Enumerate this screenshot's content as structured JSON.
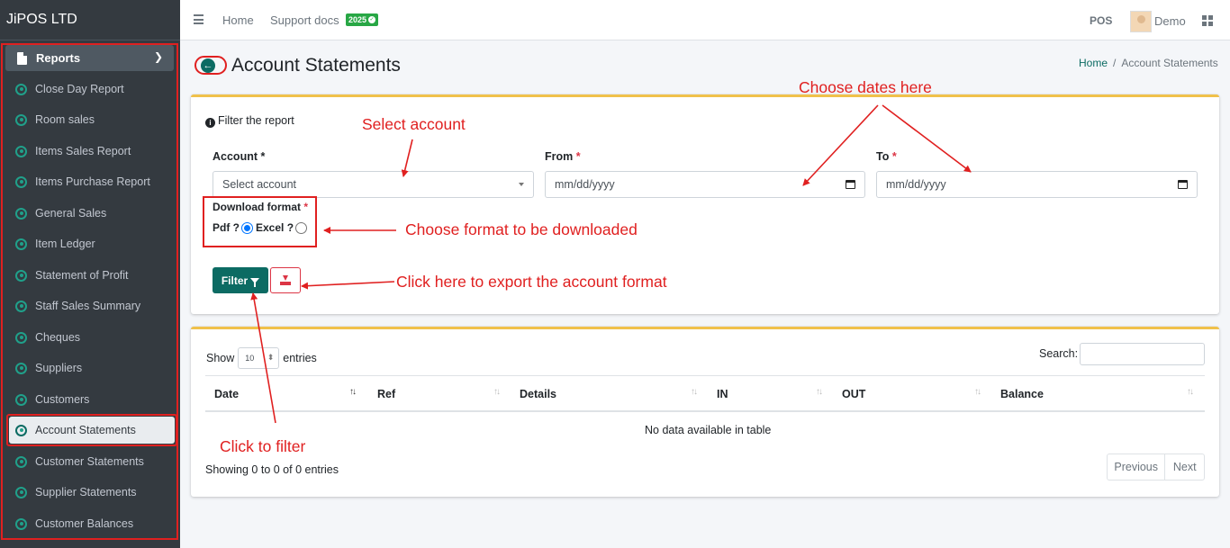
{
  "brand": "JiPOS LTD",
  "sidebar": {
    "section_label": "Reports",
    "items": [
      {
        "label": "Close Day Report"
      },
      {
        "label": "Room sales"
      },
      {
        "label": "Items Sales Report"
      },
      {
        "label": "Items Purchase Report"
      },
      {
        "label": "General Sales"
      },
      {
        "label": "Item Ledger"
      },
      {
        "label": "Statement of Profit"
      },
      {
        "label": "Staff Sales Summary"
      },
      {
        "label": "Cheques"
      },
      {
        "label": "Suppliers"
      },
      {
        "label": "Customers"
      },
      {
        "label": "Account Statements",
        "active": true
      },
      {
        "label": "Customer Statements"
      },
      {
        "label": "Supplier Statements"
      },
      {
        "label": "Customer Balances"
      }
    ]
  },
  "topbar": {
    "home": "Home",
    "support": "Support docs",
    "badge": "2025",
    "pos": "POS",
    "user": "Demo"
  },
  "header": {
    "title": "Account Statements",
    "breadcrumb_home": "Home",
    "breadcrumb_sep": "/",
    "breadcrumb_current": "Account Statements"
  },
  "filter": {
    "title": "Filter the report",
    "account_label": "Account",
    "account_placeholder": "Select account",
    "from_label": "From",
    "to_label": "To",
    "date_placeholder": "mm/dd/yyyy",
    "required_mark": "*",
    "download_label": "Download format",
    "pdf_label": "Pdf ?",
    "excel_label": "Excel ?",
    "filter_button": "Filter"
  },
  "table": {
    "show_label": "Show",
    "entries_label": "entries",
    "page_length": "10",
    "search_label": "Search:",
    "columns": [
      "Date",
      "Ref",
      "Details",
      "IN",
      "OUT",
      "Balance"
    ],
    "empty_message": "No data available in table",
    "info": "Showing 0 to 0 of 0 entries",
    "prev": "Previous",
    "next": "Next"
  },
  "annotations": {
    "choose_dates": "Choose dates here",
    "select_account": "Select account",
    "choose_format": "Choose format to be downloaded",
    "export": "Click here to export the account format",
    "click_filter": "Click to filter"
  },
  "colors": {
    "annotation": "#e02020",
    "primary": "#0c6b63",
    "sidebar": "#343a40",
    "card_top": "#f0c14b"
  }
}
